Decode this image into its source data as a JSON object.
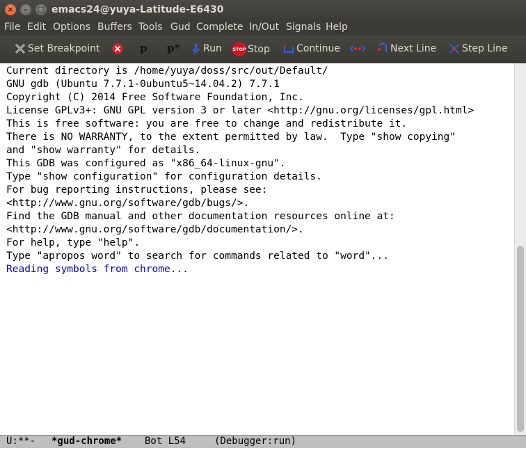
{
  "window": {
    "title": "emacs24@yuya-Latitude-E6430",
    "close_glyph": "×",
    "min_glyph": "–",
    "max_glyph": "□"
  },
  "menu": [
    "File",
    "Edit",
    "Options",
    "Buffers",
    "Tools",
    "Gud",
    "Complete",
    "In/Out",
    "Signals",
    "Help"
  ],
  "toolbar": {
    "set_breakpoint": "Set Breakpoint",
    "print_glyph": "p",
    "print_star_glyph": "p*",
    "run": "Run",
    "stop": "Stop",
    "stop_icon_text": "STOP",
    "continue": "Continue",
    "next_line": "Next Line",
    "step_line": "Step Line"
  },
  "buffer": {
    "lines": [
      "Current directory is /home/yuya/doss/src/out/Default/",
      "GNU gdb (Ubuntu 7.7.1-0ubuntu5~14.04.2) 7.7.1",
      "Copyright (C) 2014 Free Software Foundation, Inc.",
      "License GPLv3+: GNU GPL version 3 or later <http://gnu.org/licenses/gpl.html>",
      "This is free software: you are free to change and redistribute it.",
      "There is NO WARRANTY, to the extent permitted by law.  Type \"show copying\"",
      "and \"show warranty\" for details.",
      "This GDB was configured as \"x86_64-linux-gnu\".",
      "Type \"show configuration\" for configuration details.",
      "For bug reporting instructions, please see:",
      "<http://www.gnu.org/software/gdb/bugs/>.",
      "Find the GDB manual and other documentation resources online at:",
      "<http://www.gnu.org/software/gdb/documentation/>.",
      "For help, type \"help\".",
      "Type \"apropos word\" to search for commands related to \"word\"...",
      "Reading symbols from chrome..."
    ],
    "highlight_line_color": "#0000cc"
  },
  "modeline": {
    "status": "U:**-",
    "buffer_name": "*gud-chrome*",
    "position": "Bot L54",
    "mode": "(Debugger:run)"
  }
}
